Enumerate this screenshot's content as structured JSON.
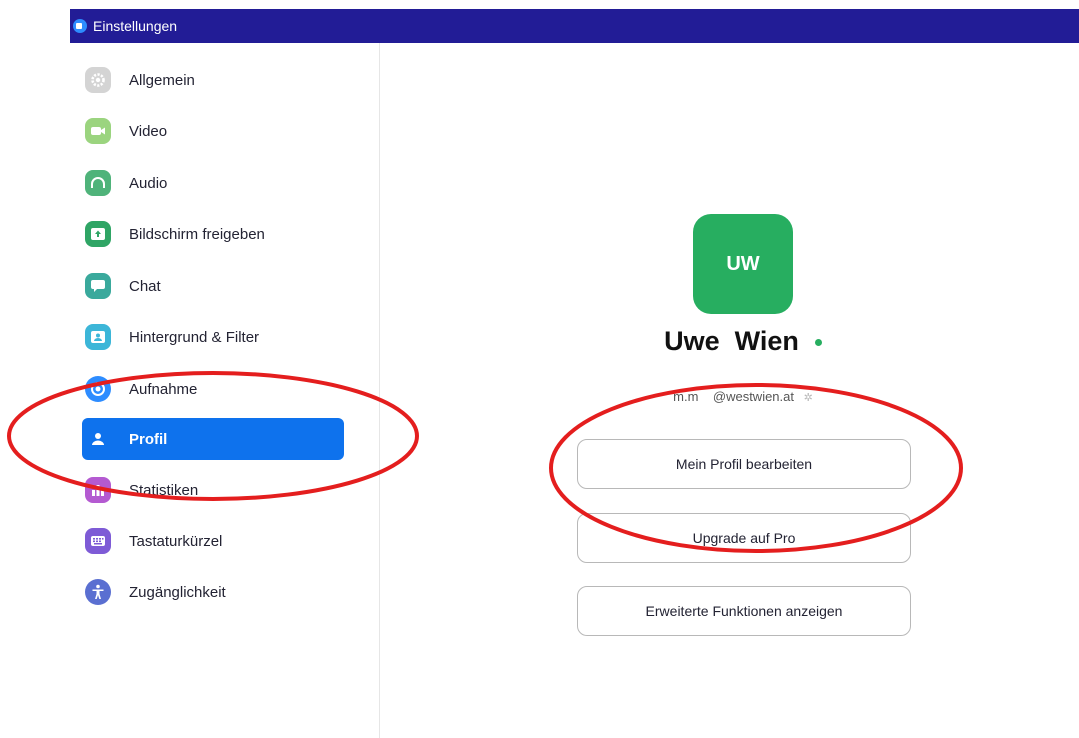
{
  "window": {
    "title": "Einstellungen"
  },
  "sidebar": {
    "items": [
      {
        "label": "Allgemein",
        "icon": "gear-icon",
        "color": "#cfcfcf"
      },
      {
        "label": "Video",
        "icon": "video-camera-icon",
        "color": "#9bd47f"
      },
      {
        "label": "Audio",
        "icon": "headphones-icon",
        "color": "#4fb37a"
      },
      {
        "label": "Bildschirm freigeben",
        "icon": "share-screen-icon",
        "color": "#2fa565"
      },
      {
        "label": "Chat",
        "icon": "chat-bubble-icon",
        "color": "#3aa99c"
      },
      {
        "label": "Hintergrund & Filter",
        "icon": "background-filter-icon",
        "color": "#3cb6d8"
      },
      {
        "label": "Aufnahme",
        "icon": "record-icon",
        "color": "#2d8cff"
      },
      {
        "label": "Profil",
        "icon": "user-icon",
        "color": "#0e72ed",
        "active": true
      },
      {
        "label": "Statistiken",
        "icon": "bar-chart-icon",
        "color": "#b45ad1"
      },
      {
        "label": "Tastaturkürzel",
        "icon": "keyboard-icon",
        "color": "#7e5bd6"
      },
      {
        "label": "Zugänglichkeit",
        "icon": "accessibility-icon",
        "color": "#5a6fd1"
      }
    ]
  },
  "profile": {
    "initials": "UW",
    "name": "Uwe  Wien",
    "email": "m.m    @westwien.at",
    "avatar_color": "#27ae60"
  },
  "buttons": {
    "edit_profile": "Mein Profil bearbeiten",
    "upgrade": "Upgrade auf Pro",
    "advanced": "Erweiterte Funktionen anzeigen"
  },
  "annotation": {
    "color": "#e41e1e"
  }
}
